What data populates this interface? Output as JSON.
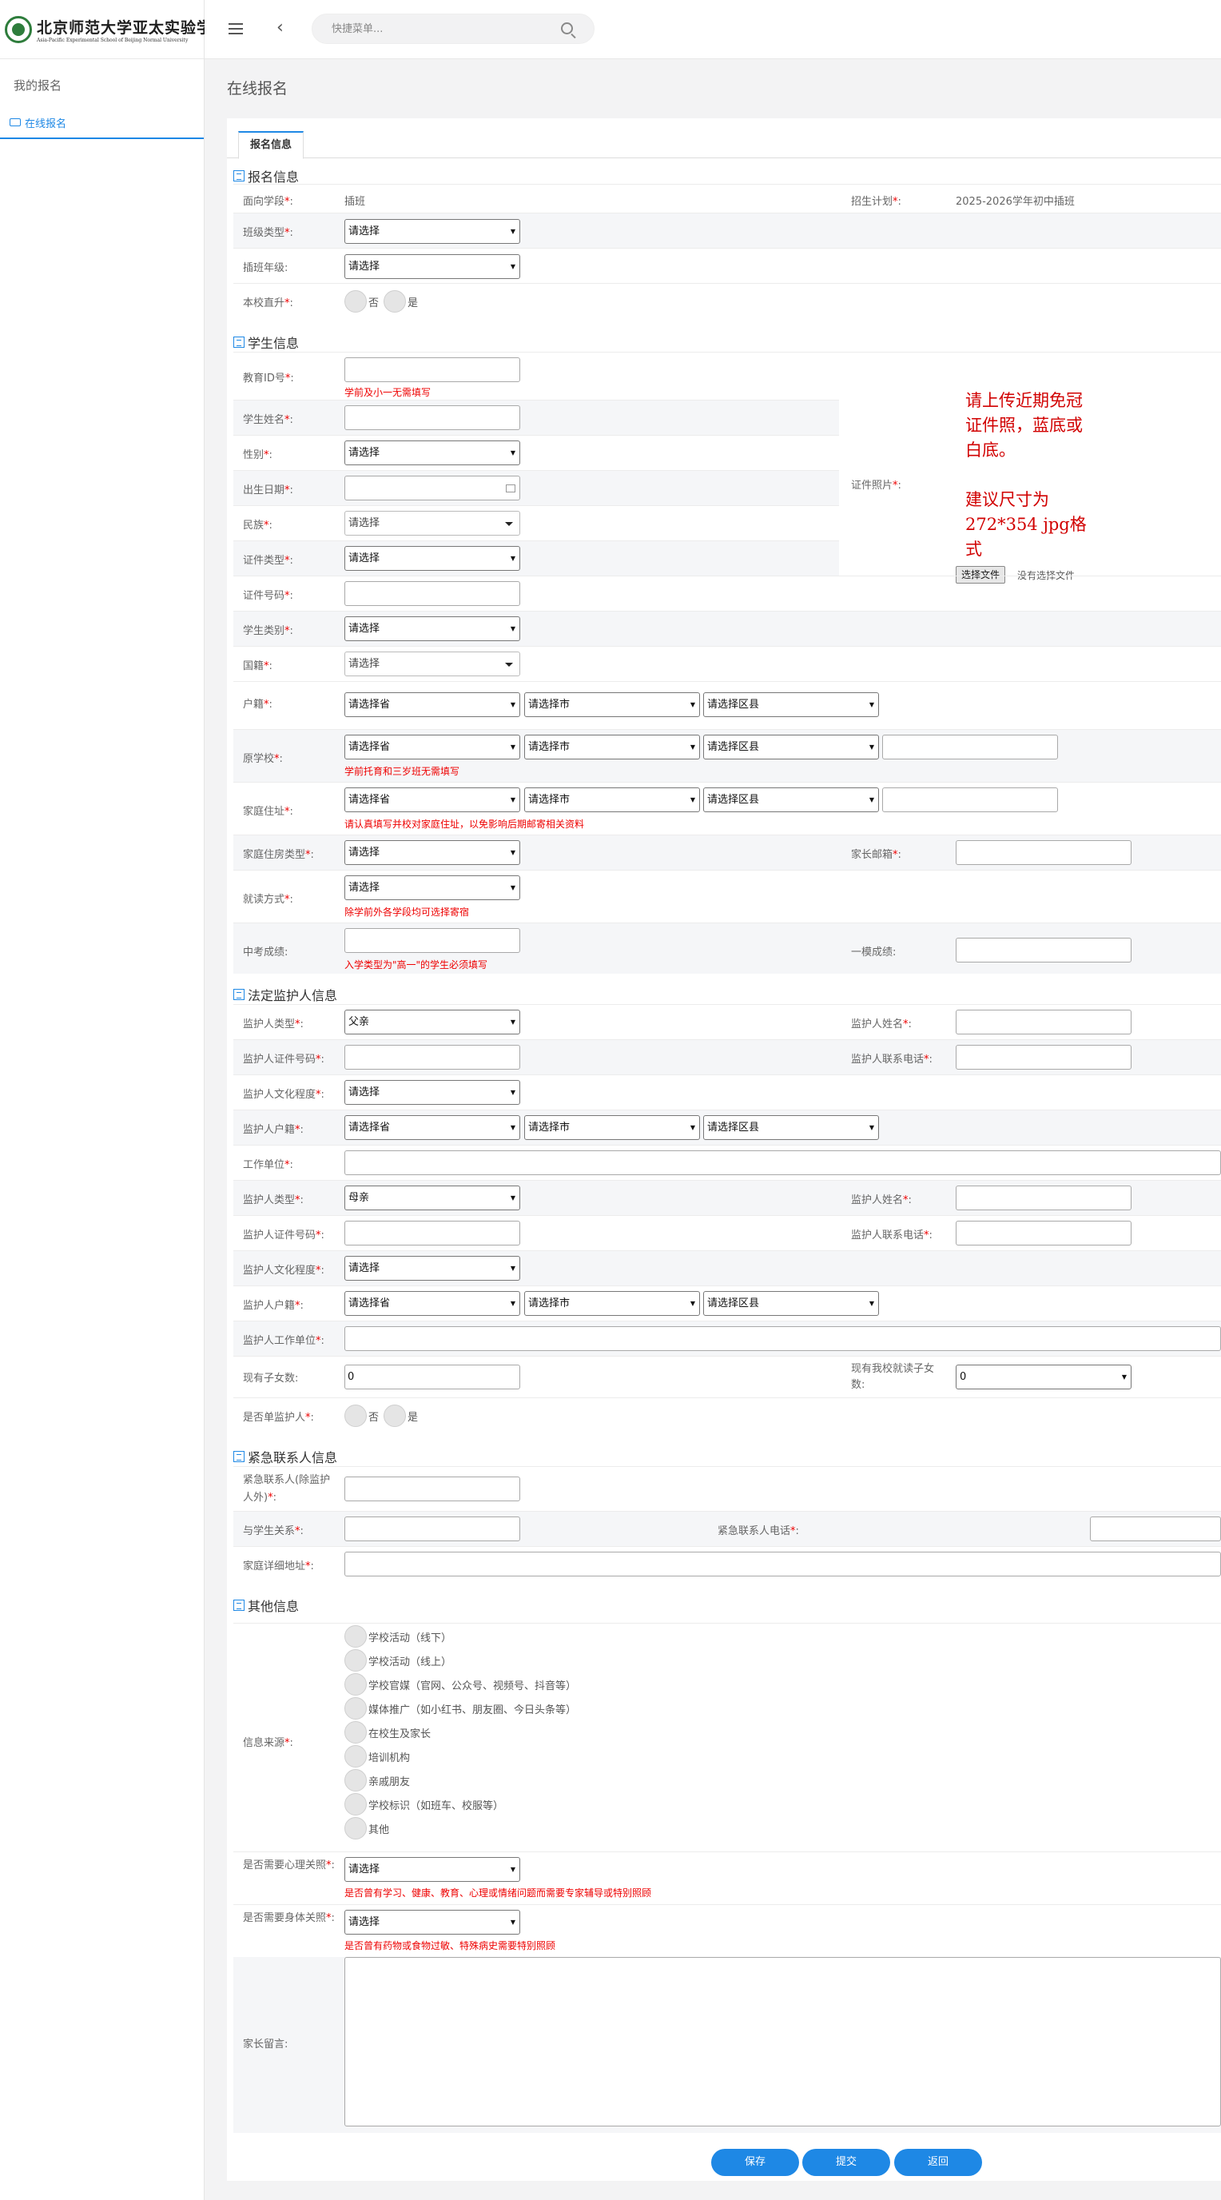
{
  "logo": {
    "cn": "北京师范大学亚太实验学校",
    "en": "Asia-Pacific Experimental School of Beijing Normal University"
  },
  "sidebar": {
    "title": "我的报名",
    "item": "在线报名"
  },
  "search": {
    "placeholder": "快捷菜单..."
  },
  "page": {
    "title": "在线报名",
    "tab": "报名信息"
  },
  "sections": {
    "baoming": "报名信息",
    "student": "学生信息",
    "guardian": "法定监护人信息",
    "emergency": "紧急联系人信息",
    "other": "其他信息"
  },
  "common": {
    "select": "请选择",
    "province": "请选择省",
    "city": "请选择市",
    "district": "请选择区县",
    "no": "否",
    "yes": "是"
  },
  "baoming": {
    "stage_label": "面向学段",
    "stage_value": "插班",
    "plan_label": "招生计划",
    "plan_value": "2025-2026学年初中插班",
    "class_type": "班级类型",
    "grade": "插班年级",
    "direct": "本校直升"
  },
  "student": {
    "edu_id": "教育ID号",
    "edu_hint": "学前及小一无需填写",
    "name": "学生姓名",
    "gender": "性别",
    "birth": "出生日期",
    "ethnic": "民族",
    "id_type": "证件类型",
    "id_no": "证件号码",
    "category": "学生类别",
    "nationality": "国籍",
    "huji": "户籍",
    "school": "原学校",
    "school_hint": "学前托育和三岁班无需填写",
    "address": "家庭住址",
    "address_hint": "请认真填写并校对家庭住址，以免影响后期邮寄相关资料",
    "housing": "家庭住房类型",
    "email": "家长邮箱",
    "study_mode": "就读方式",
    "study_hint": "除学前外各学段均可选择寄宿",
    "zhongkao": "中考成绩",
    "zhongkao_hint": "入学类型为\"高一\"的学生必须填写",
    "yimo": "一模成绩",
    "photo": "证件照片",
    "photo_note1": "请上传近期免冠证件照，蓝底或白底。",
    "photo_note2": "建议尺寸为272*354 jpg格式",
    "file_btn": "选择文件",
    "file_none": "没有选择文件"
  },
  "guardian": {
    "type": "监护人类型",
    "name": "监护人姓名",
    "cert": "监护人证件号码",
    "phone": "监护人联系电话",
    "edu": "监护人文化程度",
    "huji": "监护人户籍",
    "work": "工作单位",
    "work2": "监护人工作单位",
    "father": "父亲",
    "mother": "母亲",
    "children": "现有子女数",
    "children_value": "0",
    "in_school": "现有我校就读子女数",
    "in_school_value": "0",
    "single": "是否单监护人"
  },
  "emergency": {
    "contact": "紧急联系人(除监护人外)",
    "relation": "与学生关系",
    "phone": "紧急联系人电话",
    "home": "家庭详细地址"
  },
  "other": {
    "source": "信息来源",
    "options": [
      "学校活动（线下）",
      "学校活动（线上）",
      "学校官媒（官网、公众号、视频号、抖音等）",
      "媒体推广（如小红书、朋友圈、今日头条等）",
      "在校生及家长",
      "培训机构",
      "亲戚朋友",
      "学校标识（如班车、校服等）",
      "其他"
    ],
    "psych": "是否需要心理关照",
    "psych_hint": "是否曾有学习、健康、教育、心理或情绪问题而需要专家辅导或特别照顾",
    "body": "是否需要身体关照",
    "body_hint": "是否曾有药物或食物过敏、特殊病史需要特别照顾",
    "message": "家长留言"
  },
  "buttons": {
    "save": "保存",
    "submit": "提交",
    "back": "返回"
  },
  "colors": {
    "accent": "#1e88e5",
    "required": "#e00000"
  }
}
